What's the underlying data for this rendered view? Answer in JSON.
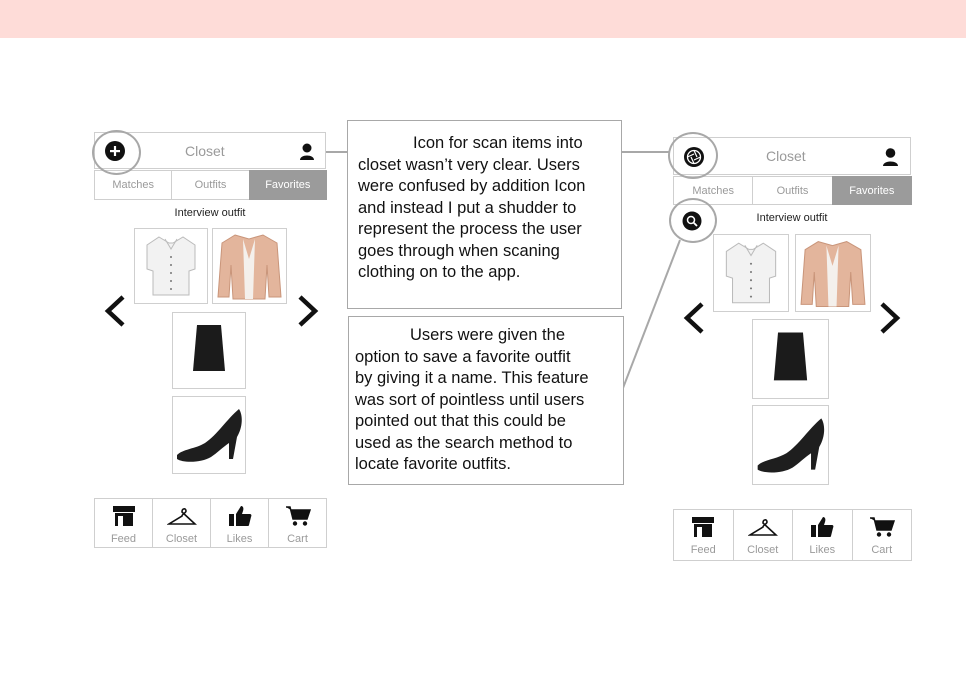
{
  "colors": {
    "top_band": "#fedcd8",
    "active_tab": "#9b9b9b",
    "muted_text": "#9a9a9a",
    "callout_border": "#a8a8a8"
  },
  "left_mockup": {
    "header_title": "Closet",
    "tabs": [
      {
        "label": "Matches",
        "active": false
      },
      {
        "label": "Outfits",
        "active": false
      },
      {
        "label": "Favorites",
        "active": true
      }
    ],
    "outfit_name": "Interview outfit",
    "icons": {
      "header_left": "add-circle-icon",
      "header_right": "user-icon"
    },
    "nav": [
      {
        "label": "Feed",
        "icon": "store-icon"
      },
      {
        "label": "Closet",
        "icon": "hanger-icon"
      },
      {
        "label": "Likes",
        "icon": "thumbs-up-icon"
      },
      {
        "label": "Cart",
        "icon": "cart-icon"
      }
    ]
  },
  "right_mockup": {
    "header_title": "Closet",
    "tabs": [
      {
        "label": "Matches",
        "active": false
      },
      {
        "label": "Outfits",
        "active": false
      },
      {
        "label": "Favorites",
        "active": true
      }
    ],
    "outfit_name": "Interview outfit",
    "icons": {
      "header_left": "camera-shutter-icon",
      "header_right": "user-icon",
      "search": "search-icon"
    },
    "nav": [
      {
        "label": "Feed",
        "icon": "store-icon"
      },
      {
        "label": "Closet",
        "icon": "hanger-icon"
      },
      {
        "label": "Likes",
        "icon": "thumbs-up-icon"
      },
      {
        "label": "Cart",
        "icon": "cart-icon"
      }
    ]
  },
  "callouts": {
    "scan": {
      "lines": [
        "            Icon for scan items into",
        "closet wasn’t very clear. Users",
        "were confused by addition Icon",
        "and instead I put a shudder to",
        "represent the process the user",
        "goes through when scaning",
        "clothing on to the app."
      ]
    },
    "favorite": {
      "lines": [
        "            Users were given the",
        "option to save a favorite outfit",
        "by giving it a name. This feature",
        "was sort of pointless until users",
        "pointed out that this could be",
        "used as the search method to",
        "locate favorite outfits."
      ]
    }
  }
}
